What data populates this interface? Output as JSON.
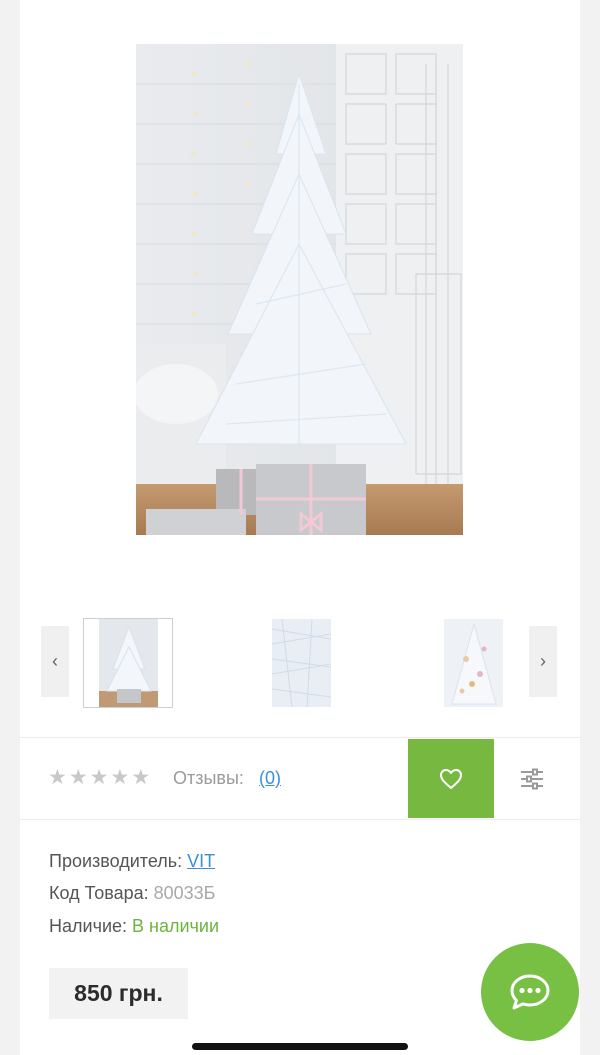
{
  "gallery": {
    "prev_arrow": "‹",
    "next_arrow": "›"
  },
  "rating": {
    "stars": [
      "★",
      "★",
      "★",
      "★",
      "★"
    ],
    "reviews_label": "Отзывы:",
    "reviews_count": "(0)"
  },
  "info": {
    "manufacturer_label": "Производитель:",
    "manufacturer_value": "VIT",
    "code_label": "Код Товара:",
    "code_value": "80033Б",
    "availability_label": "Наличие:",
    "availability_value": "В наличии"
  },
  "price": "850 грн.",
  "colors": {
    "accent_green": "#77b940",
    "link_blue": "#3b8fd9",
    "availability_green": "#6cb33f"
  }
}
